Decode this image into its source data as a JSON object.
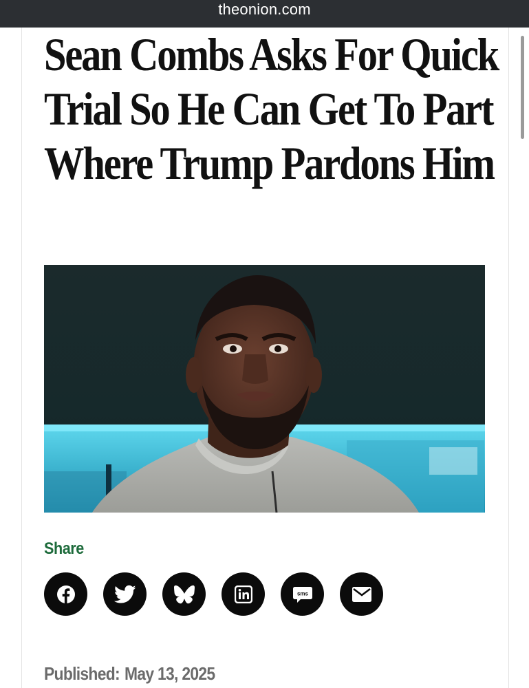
{
  "browser": {
    "url": "theonion.com"
  },
  "article": {
    "headline": "Sean Combs Asks For Quick Trial So He Can Get To Part Where Trump Pardons Him",
    "image_alt": "Sean Combs"
  },
  "share": {
    "label": "Share",
    "buttons": [
      {
        "name": "facebook",
        "icon": "facebook-icon"
      },
      {
        "name": "twitter",
        "icon": "twitter-icon"
      },
      {
        "name": "bluesky",
        "icon": "bluesky-icon"
      },
      {
        "name": "linkedin",
        "icon": "linkedin-icon"
      },
      {
        "name": "sms",
        "icon": "sms-icon",
        "text": "sms"
      },
      {
        "name": "email",
        "icon": "email-icon"
      }
    ]
  },
  "meta": {
    "published_label": "Published:",
    "published_date": "May 13, 2025"
  },
  "colors": {
    "url_bar": "#2c2f33",
    "share_accent": "#1d6b3b",
    "share_button": "#0b0b0b",
    "meta_text": "#6b6b6b"
  }
}
